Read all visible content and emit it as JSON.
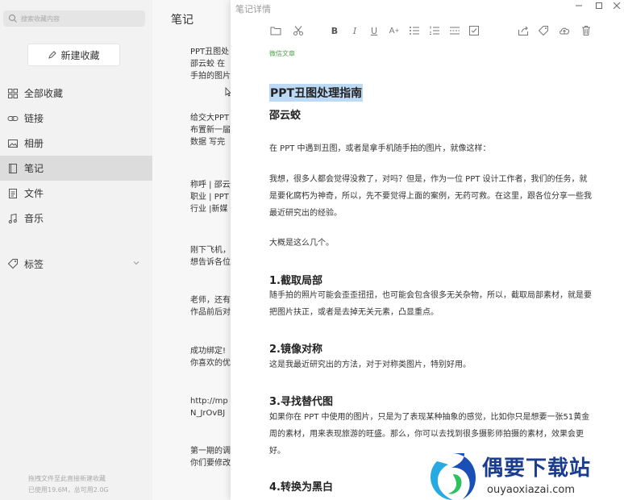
{
  "sidebar": {
    "search_placeholder": "搜索收藏内容",
    "new_button": "新建收藏",
    "nav": [
      {
        "label": "全部收藏",
        "icon": "grid-icon"
      },
      {
        "label": "链接",
        "icon": "link-icon"
      },
      {
        "label": "相册",
        "icon": "image-icon"
      },
      {
        "label": "笔记",
        "icon": "note-icon",
        "active": true
      },
      {
        "label": "文件",
        "icon": "file-icon"
      },
      {
        "label": "音乐",
        "icon": "music-icon"
      }
    ],
    "tags_label": "标签",
    "footer_line1": "拖拽文件至此直接新建收藏",
    "footer_line2": "已使用19.6M，总可用2.0G"
  },
  "notes": {
    "title": "笔记",
    "items": [
      "PPT丑图处\n邵云蛟 在\n手拍的图片",
      "给交大PPT\n布置新一届\n数据 写完",
      "称呼 | 邵云\n职业 | PPT\n行业 |新媒",
      "刚下飞机，\n想告诉各位",
      "老师，还有\n作品前后对",
      "成功绑定!\n你喜欢的优",
      "http://mp\nN_JrOvBJ",
      "第一期的调\n你们要修改"
    ]
  },
  "detail": {
    "window_title": "笔记详情",
    "tag": "微信文章",
    "title": "PPT丑图处理指南",
    "author": "邵云蛟",
    "p1": "在 PPT 中遇到丑图，或者是拿手机随手拍的图片，就像这样：",
    "p2": "我想，很多人都会觉得没救了，对吗？但是，作为一位 PPT 设计工作者，我们的任务，就是要化腐朽为神奇，所以，先不要觉得上面的案例，无药可救。在这里，跟各位分享一些我最近研究出的经验。",
    "p3": "大概是这么几个。",
    "s1": "1.截取局部",
    "s1p": "随手拍的照片可能会歪歪扭扭，也可能会包含很多无关杂物，所以，截取局部素材，就是要把图片扶正，或者是去掉无关元素，凸显重点。",
    "s2": "2.镜像对称",
    "s2p": "这是我最近研究出的方法，对于对称类图片，特别好用。",
    "s3": "3.寻找替代图",
    "s3p": "如果你在 PPT 中使用的图片，只是为了表现某种抽象的感觉，比如你只是想要一张51黄金周的素材，用来表现旅游的旺盛。那么，你可以去找到很多摄影师拍摄的素材，效果会更好。",
    "s4": "4.转换为黑白"
  },
  "watermark": {
    "big": "偶要下载站",
    "small": "ouyaoxiazai.com"
  },
  "colors": {
    "sidebar_bg": "#f2f2f2",
    "active_nav_bg": "#dcdcdc",
    "title_highlight": "#bcd9f5",
    "tag_green": "#52a352",
    "watermark_blue": "#1a3d8f"
  }
}
